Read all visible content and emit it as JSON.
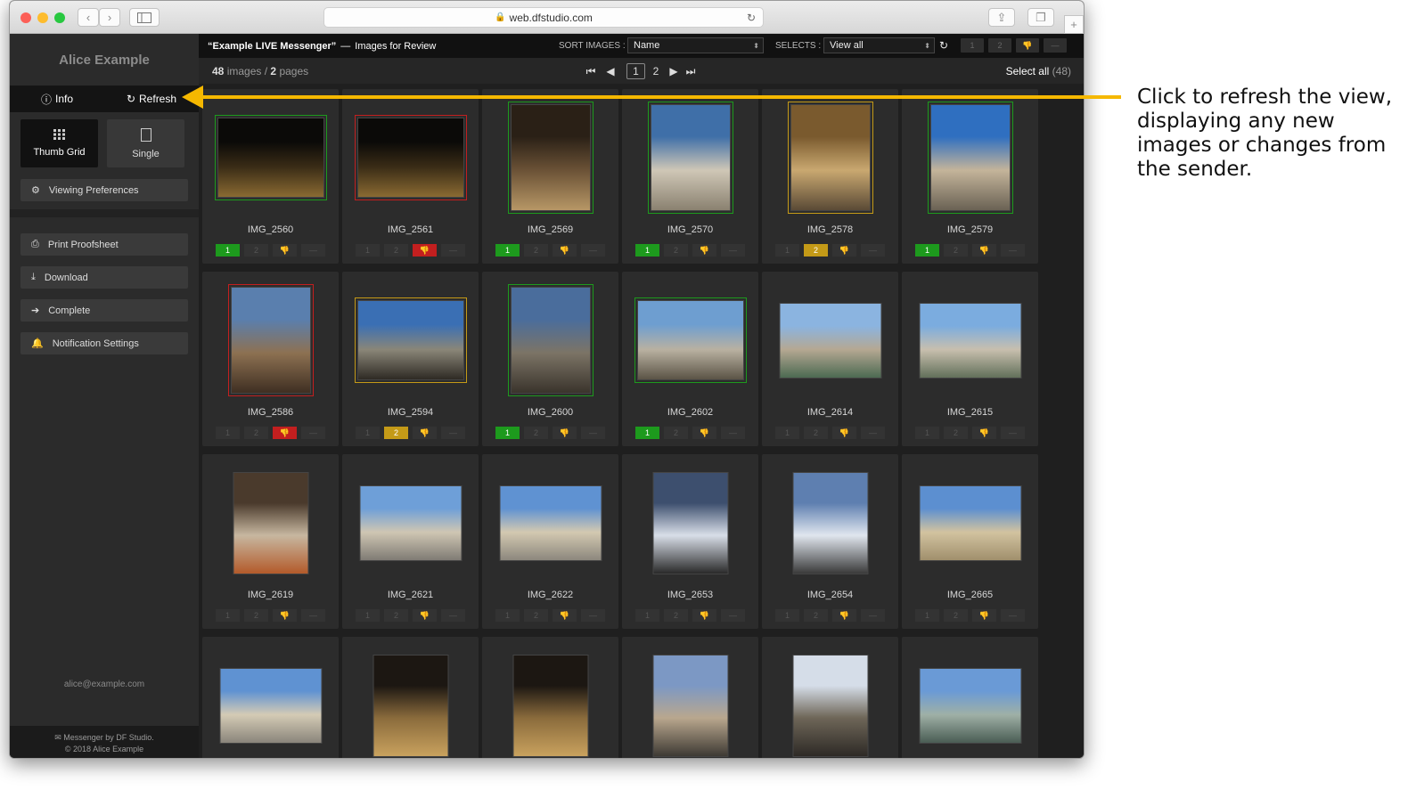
{
  "browser": {
    "url": "web.dfstudio.com"
  },
  "sidebar": {
    "user": "Alice Example",
    "tabs": {
      "info": "Info",
      "refresh": "Refresh"
    },
    "views": {
      "thumb_grid": "Thumb Grid",
      "single": "Single"
    },
    "viewing_preferences": "Viewing Preferences",
    "actions": {
      "print": "Print Proofsheet",
      "download": "Download",
      "complete": "Complete",
      "notifications": "Notification Settings"
    },
    "email": "alice@example.com",
    "footer_line1": "Messenger by DF Studio.",
    "footer_line2": "© 2018 Alice Example"
  },
  "header": {
    "title": "“Example LIVE Messenger”",
    "title_sep": "—",
    "subtitle": "Images for Review",
    "sort_label": "SORT IMAGES :",
    "sort_value": "Name",
    "selects_label": "SELECTS :",
    "selects_value": "View all",
    "mini_buttons": [
      "1",
      "2",
      "",
      ""
    ]
  },
  "subbar": {
    "images_count": "48",
    "images_word": "images /",
    "pages_count": "2",
    "pages_word": "pages",
    "current_page": "1",
    "next_page": "2",
    "select_all": "Select all",
    "select_all_count": "(48)"
  },
  "images": [
    {
      "name": "IMG_2560",
      "rating": "1",
      "state": "green"
    },
    {
      "name": "IMG_2561",
      "rating": "",
      "state": "red"
    },
    {
      "name": "IMG_2569",
      "rating": "1",
      "state": "green"
    },
    {
      "name": "IMG_2570",
      "rating": "1",
      "state": "green"
    },
    {
      "name": "IMG_2578",
      "rating": "2",
      "state": "yellow"
    },
    {
      "name": "IMG_2579",
      "rating": "1",
      "state": "green"
    },
    {
      "name": "IMG_2586",
      "rating": "",
      "state": "red"
    },
    {
      "name": "IMG_2594",
      "rating": "2",
      "state": "yellow"
    },
    {
      "name": "IMG_2600",
      "rating": "1",
      "state": "green"
    },
    {
      "name": "IMG_2602",
      "rating": "1",
      "state": "green"
    },
    {
      "name": "IMG_2614",
      "rating": "",
      "state": "none"
    },
    {
      "name": "IMG_2615",
      "rating": "",
      "state": "none"
    },
    {
      "name": "IMG_2619",
      "rating": "",
      "state": "none"
    },
    {
      "name": "IMG_2621",
      "rating": "",
      "state": "none"
    },
    {
      "name": "IMG_2622",
      "rating": "",
      "state": "none"
    },
    {
      "name": "IMG_2653",
      "rating": "",
      "state": "none"
    },
    {
      "name": "IMG_2654",
      "rating": "",
      "state": "none"
    },
    {
      "name": "IMG_2665",
      "rating": "",
      "state": "none"
    },
    {
      "name": "",
      "rating": "",
      "state": "none"
    },
    {
      "name": "",
      "rating": "",
      "state": "none"
    },
    {
      "name": "",
      "rating": "",
      "state": "none"
    },
    {
      "name": "",
      "rating": "",
      "state": "none"
    },
    {
      "name": "",
      "rating": "",
      "state": "none"
    },
    {
      "name": "",
      "rating": "",
      "state": "none"
    }
  ],
  "callout": {
    "text": "Click to refresh the view, displaying any new images or changes from the sender.",
    "arrow_color": "#f5b800"
  },
  "colors": {
    "green": "#1d9a1d",
    "red": "#c31f1f",
    "yellow": "#c49a17"
  }
}
